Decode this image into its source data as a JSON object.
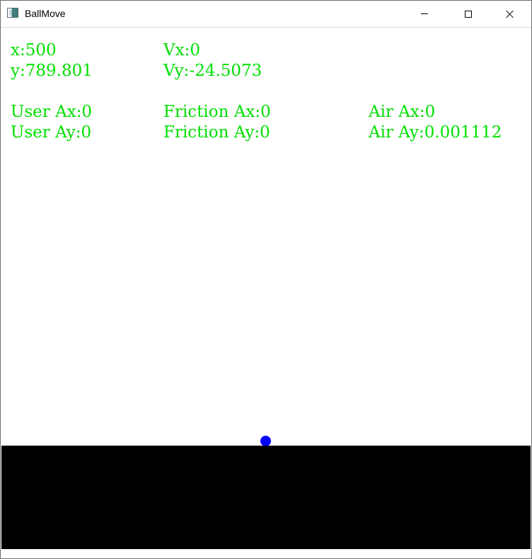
{
  "window": {
    "title": "BallMove",
    "icon": "app-window-icon",
    "buttons": {
      "minimize": "minimize-icon",
      "maximize": "maximize-icon",
      "close": "close-icon"
    }
  },
  "colors": {
    "text": "#00e000",
    "ball": "#0000ff",
    "ground": "#000000",
    "background": "#ffffff"
  },
  "readouts": {
    "x": "x:500",
    "y": "y:789.801",
    "vx": "Vx:0",
    "vy": "Vy:-24.5073",
    "user_ax": "User Ax:0",
    "user_ay": "User Ay:0",
    "friction_ax": "Friction Ax:0",
    "friction_ay": "Friction Ay:0",
    "air_ax": "Air Ax:0",
    "air_ay": "Air Ay:0.001112"
  }
}
